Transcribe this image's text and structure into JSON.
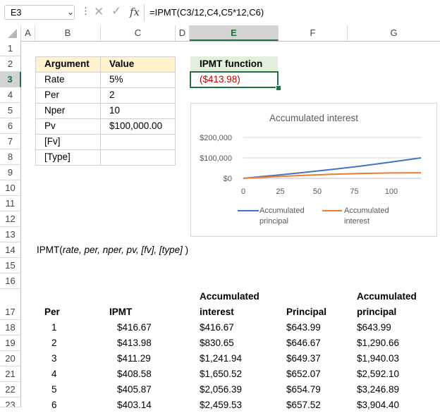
{
  "formula_bar": {
    "name_box": "E3",
    "cancel_glyph": "✕",
    "enter_glyph": "✓",
    "fx_glyph": "fx",
    "formula": "=IPMT(C3/12,C4,C5*12,C6)"
  },
  "columns": [
    "A",
    "B",
    "C",
    "D",
    "E",
    "F",
    "G"
  ],
  "rows": [
    "1",
    "2",
    "3",
    "4",
    "5",
    "6",
    "7",
    "8",
    "9",
    "10",
    "11",
    "12",
    "13",
    "14",
    "15",
    "16",
    "17",
    "18",
    "19",
    "20",
    "21",
    "22",
    "23"
  ],
  "selected_cell": {
    "column": "E",
    "row": "3"
  },
  "colors": {
    "header_fill": "#fff2cc",
    "result_header_fill": "#e2efda",
    "negative_text": "#c00000",
    "selection_border": "#217346",
    "series_principal": "#4472c4",
    "series_interest": "#ed7d31"
  },
  "arguments_table": {
    "headers": [
      "Argument",
      "Value"
    ],
    "rows": [
      [
        "Rate",
        "5%"
      ],
      [
        "Per",
        "2"
      ],
      [
        "Nper",
        "10"
      ],
      [
        "Pv",
        "$100,000.00"
      ],
      [
        "[Fv]",
        ""
      ],
      [
        "[Type]",
        ""
      ]
    ]
  },
  "result": {
    "header": "IPMT function",
    "value": "($413.98)"
  },
  "syntax": {
    "fn": "IPMT(",
    "args": "rate, per, nper, pv, [fv], [type]",
    "close": " )"
  },
  "schedule_table": {
    "headers": {
      "per": "Per",
      "ipmt": "IPMT",
      "acc_interest_1": "Accumulated",
      "acc_interest_2": "interest",
      "principal": "Principal",
      "acc_principal_1": "Accumulated",
      "acc_principal_2": "principal"
    },
    "rows": [
      [
        "1",
        "$416.67",
        "$416.67",
        "$643.99",
        "$643.99"
      ],
      [
        "2",
        "$413.98",
        "$830.65",
        "$646.67",
        "$1,290.66"
      ],
      [
        "3",
        "$411.29",
        "$1,241.94",
        "$649.37",
        "$1,940.03"
      ],
      [
        "4",
        "$408.58",
        "$1,650.52",
        "$652.07",
        "$2,592.10"
      ],
      [
        "5",
        "$405.87",
        "$2,056.39",
        "$654.79",
        "$3,246.89"
      ],
      [
        "6",
        "$403.14",
        "$2,459.53",
        "$657.52",
        "$3,904.40"
      ]
    ]
  },
  "chart_data": {
    "type": "line",
    "title": "Accumulated interest",
    "xlim": [
      0,
      120
    ],
    "ylim": [
      0,
      200000
    ],
    "x_ticks": [
      "0",
      "25",
      "50",
      "75",
      "100"
    ],
    "x_tick_values": [
      0,
      25,
      50,
      75,
      100
    ],
    "y_ticks": [
      "$0",
      "$100,000",
      "$200,000"
    ],
    "y_tick_values": [
      0,
      100000,
      200000
    ],
    "grid": true,
    "legend_placement": "bottom",
    "x": [
      0,
      20,
      40,
      60,
      80,
      100,
      120
    ],
    "series": [
      {
        "name": "Accumulated principal",
        "values": [
          0,
          13500,
          28000,
          43500,
          60500,
          79500,
          100000
        ]
      },
      {
        "name": "Accumulated interest",
        "values": [
          0,
          7600,
          14100,
          19500,
          23700,
          26300,
          27280
        ]
      }
    ]
  }
}
